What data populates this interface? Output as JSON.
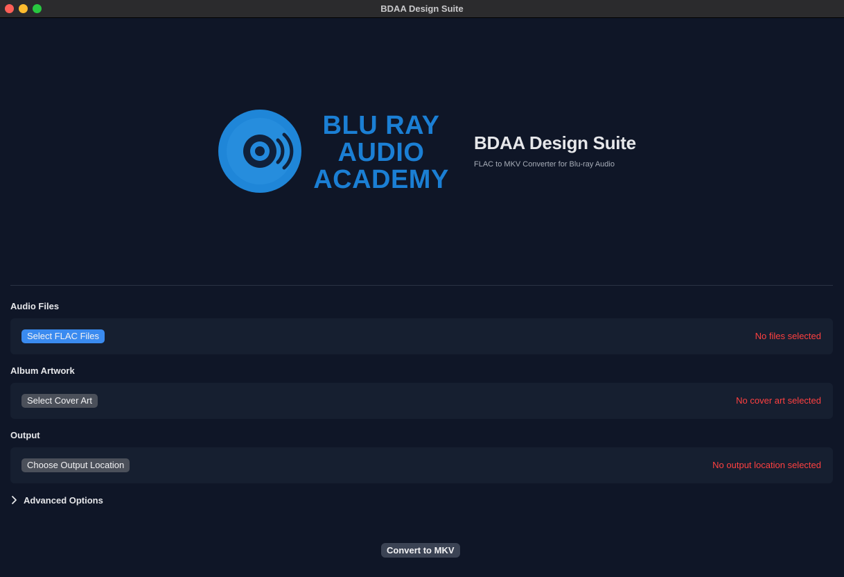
{
  "window": {
    "title": "BDAA Design Suite"
  },
  "logo": {
    "lines": [
      "BLU RAY",
      "AUDIO",
      "ACADEMY"
    ],
    "color": "#1b7fd4"
  },
  "header": {
    "title": "BDAA Design Suite",
    "subtitle": "FLAC to MKV Converter for Blu-ray Audio"
  },
  "sections": {
    "audio": {
      "label": "Audio Files",
      "button": "Select FLAC Files",
      "status": "No files selected"
    },
    "artwork": {
      "label": "Album Artwork",
      "button": "Select Cover Art",
      "status": "No cover art selected"
    },
    "output": {
      "label": "Output",
      "button": "Choose Output Location",
      "status": "No output location selected"
    }
  },
  "advanced": {
    "label": "Advanced Options",
    "icon": "chevron-right-icon"
  },
  "convert": {
    "label": "Convert to MKV"
  },
  "colors": {
    "background": "#0f1627",
    "panel": "#161f30",
    "accent": "#3a8bf0",
    "error": "#ff4040"
  }
}
